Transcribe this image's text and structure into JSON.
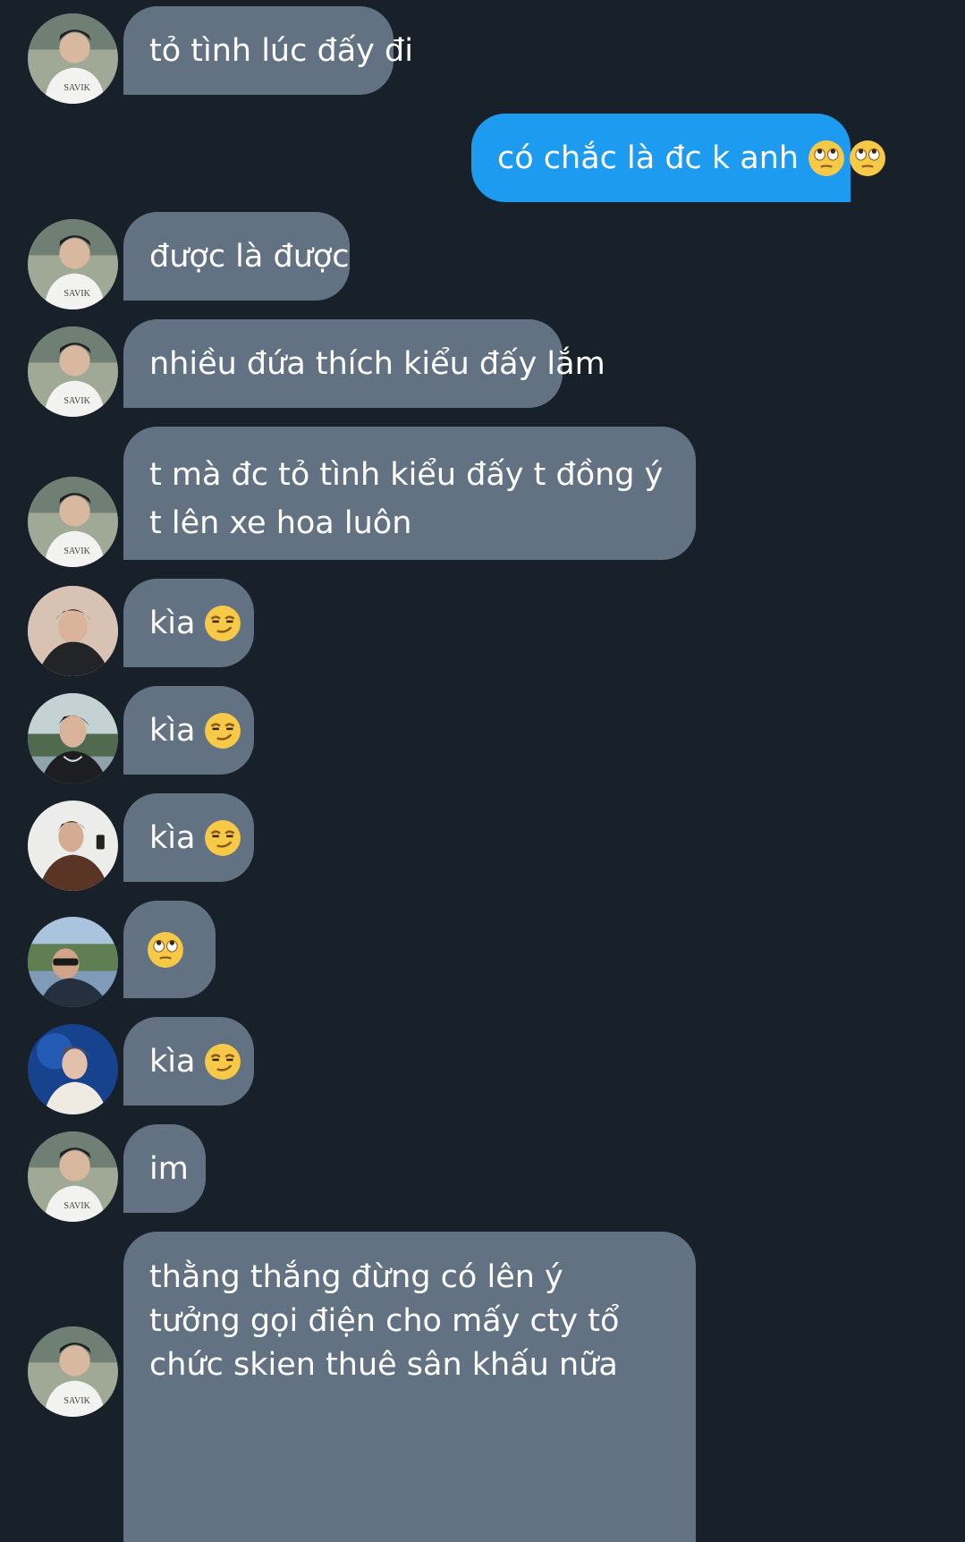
{
  "messages": [
    {
      "text": "tỏ tình lúc đấy đi",
      "emojis": [],
      "avatar": "avatar-a"
    },
    {
      "text": "có chắc là đc k anh",
      "emojis": [
        "face-with-rolling-eyes-icon",
        "face-with-rolling-eyes-icon"
      ],
      "outgoing": true
    },
    {
      "text": "được là được",
      "emojis": [],
      "avatar": "avatar-a"
    },
    {
      "text": "nhiều đứa thích kiểu đấy lắm",
      "emojis": [],
      "avatar": "avatar-a"
    },
    {
      "text": "t mà đc tỏ tình kiểu đấy t đồng ý t lên xe hoa luôn",
      "emojis": [],
      "avatar": "avatar-a"
    },
    {
      "text": "kìa",
      "emojis": [
        "smirking-face-icon"
      ],
      "avatar": "avatar-b"
    },
    {
      "text": "kìa",
      "emojis": [
        "smirking-face-icon"
      ],
      "avatar": "avatar-c"
    },
    {
      "text": "kìa",
      "emojis": [
        "smirking-face-icon"
      ],
      "avatar": "avatar-d"
    },
    {
      "text": "",
      "emojis": [
        "face-with-rolling-eyes-icon"
      ],
      "avatar": "avatar-e"
    },
    {
      "text": "kìa",
      "emojis": [
        "smirking-face-icon"
      ],
      "avatar": "avatar-f"
    },
    {
      "text": "im",
      "emojis": [],
      "avatar": "avatar-a"
    },
    {
      "text": "thằng thắng đừng có lên ý tưởng gọi điện cho mấy cty tổ chức skien thuê sân khấu nữa",
      "emojis": [],
      "avatar": "avatar-a"
    }
  ],
  "colors": {
    "background": "#18202a",
    "incoming_bubble": "#637283",
    "outgoing_bubble": "#1d9bf0",
    "text": "#ffffff"
  }
}
